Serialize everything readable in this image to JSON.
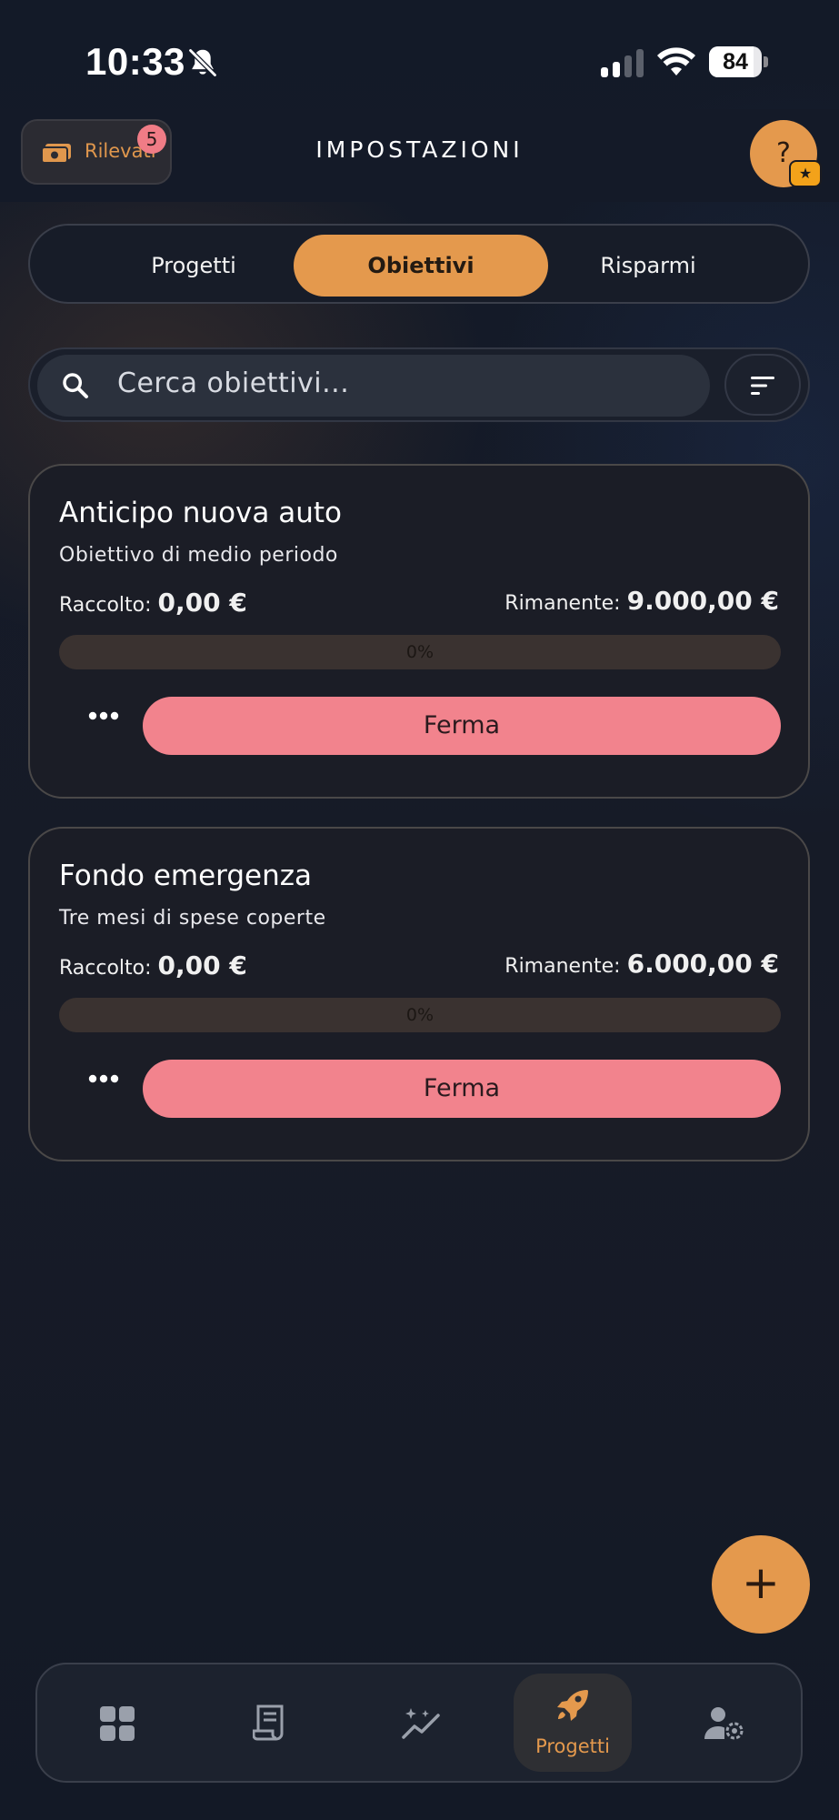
{
  "status_bar": {
    "time": "10:33",
    "battery": "84",
    "battery_level": 0.84
  },
  "header": {
    "left_button_label": "Rilevati",
    "left_button_badge": "5",
    "title": "IMPOSTAZIONI",
    "help_label": "?",
    "help_badge_icon": "star-icon"
  },
  "tabs": [
    {
      "label": "Progetti",
      "active": false
    },
    {
      "label": "Obiettivi",
      "active": true
    },
    {
      "label": "Risparmi",
      "active": false
    }
  ],
  "search": {
    "placeholder": "Cerca obiettivi..."
  },
  "goals": [
    {
      "title": "Anticipo nuova auto",
      "subtitle": "Obiettivo di medio periodo",
      "collected_label": "Raccolto:",
      "collected_value": "0,00 €",
      "remaining_label": "Rimanente:",
      "remaining_value": "9.000,00 €",
      "progress_text": "0%",
      "progress": 0,
      "more_icon": "more-horizontal-icon",
      "stop_label": "Ferma"
    },
    {
      "title": "Fondo emergenza",
      "subtitle": "Tre mesi di spese coperte",
      "collected_label": "Raccolto:",
      "collected_value": "0,00 €",
      "remaining_label": "Rimanente:",
      "remaining_value": "6.000,00 €",
      "progress_text": "0%",
      "progress": 0,
      "more_icon": "more-horizontal-icon",
      "stop_label": "Ferma"
    }
  ],
  "fab": {
    "label": "+"
  },
  "bottom_nav": [
    {
      "icon": "dashboard-grid-icon",
      "label": "",
      "active": false
    },
    {
      "icon": "receipt-icon",
      "label": "",
      "active": false
    },
    {
      "icon": "sparkle-chart-icon",
      "label": "",
      "active": false
    },
    {
      "icon": "rocket-icon",
      "label": "Progetti",
      "active": true
    },
    {
      "icon": "user-settings-icon",
      "label": "",
      "active": false
    }
  ],
  "colors": {
    "accent": "#e4994d",
    "stop_button": "#f2838d",
    "background": "#141b29",
    "badge": "#f07c86"
  }
}
